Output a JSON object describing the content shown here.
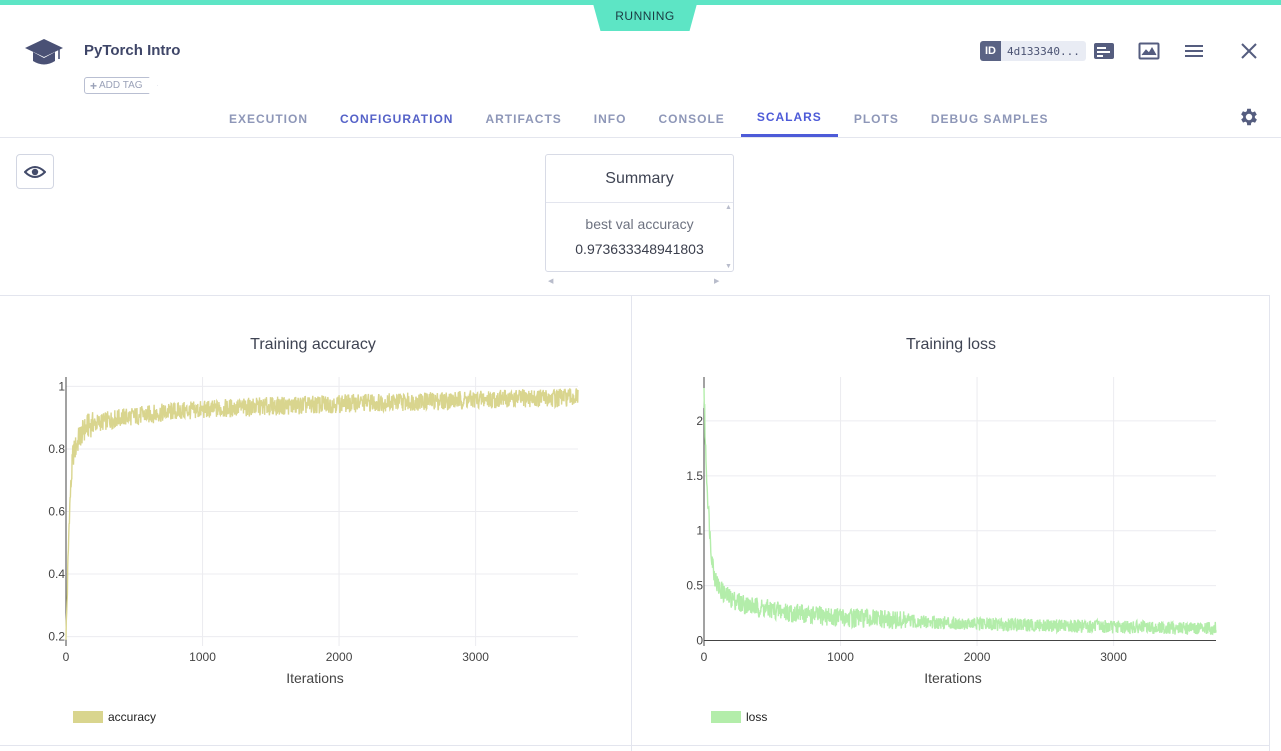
{
  "status": "RUNNING",
  "header": {
    "title": "PyTorch Intro",
    "add_tag": "ADD TAG",
    "id_label": "ID",
    "id_value": "4d133340...",
    "icons": [
      "details-icon",
      "chart-panel-icon",
      "menu-icon",
      "close-icon"
    ]
  },
  "tabs": [
    {
      "label": "EXECUTION"
    },
    {
      "label": "CONFIGURATION"
    },
    {
      "label": "ARTIFACTS"
    },
    {
      "label": "INFO"
    },
    {
      "label": "CONSOLE"
    },
    {
      "label": "SCALARS"
    },
    {
      "label": "PLOTS"
    },
    {
      "label": "DEBUG SAMPLES"
    }
  ],
  "active_tab": "SCALARS",
  "summary": {
    "title": "Summary",
    "label": "best val accuracy",
    "value": "0.973633348941803"
  },
  "colors": {
    "accent": "#4d5bd8",
    "status": "#5de5c5",
    "accuracy_series": "#d9d58e",
    "loss_series": "#b3edaa"
  },
  "chart_data": [
    {
      "type": "line",
      "title": "Training accuracy",
      "xlabel": "Iterations",
      "ylabel": "",
      "xlim": [
        0,
        3750
      ],
      "ylim": [
        0.17,
        1.03
      ],
      "xticks": [
        "0",
        "1000",
        "2000",
        "3000"
      ],
      "yticks": [
        "0.2",
        "0.4",
        "0.6",
        "0.8",
        "1"
      ],
      "grid": true,
      "legend_position": "bottom-left",
      "series": [
        {
          "name": "accuracy",
          "x": [
            0,
            25,
            50,
            100,
            150,
            200,
            300,
            400,
            500,
            600,
            700,
            800,
            900,
            1000,
            1200,
            1400,
            1600,
            1800,
            2000,
            2200,
            2400,
            2600,
            2800,
            3000,
            3200,
            3400,
            3600,
            3750
          ],
          "values": [
            0.19,
            0.6,
            0.78,
            0.84,
            0.87,
            0.88,
            0.89,
            0.9,
            0.905,
            0.91,
            0.915,
            0.92,
            0.922,
            0.925,
            0.93,
            0.935,
            0.938,
            0.94,
            0.945,
            0.948,
            0.95,
            0.952,
            0.955,
            0.958,
            0.96,
            0.962,
            0.963,
            0.965
          ]
        }
      ]
    },
    {
      "type": "line",
      "title": "Training loss",
      "xlabel": "Iterations",
      "ylabel": "",
      "xlim": [
        0,
        3750
      ],
      "ylim": [
        -0.05,
        2.4
      ],
      "xticks": [
        "0",
        "1000",
        "2000",
        "3000"
      ],
      "yticks": [
        "0",
        "0.5",
        "1",
        "1.5",
        "2"
      ],
      "grid": true,
      "legend_position": "bottom-left",
      "series": [
        {
          "name": "loss",
          "x": [
            0,
            10,
            25,
            50,
            75,
            100,
            150,
            200,
            300,
            400,
            500,
            600,
            800,
            1000,
            1200,
            1400,
            1600,
            1800,
            2000,
            2200,
            2400,
            2600,
            2800,
            3000,
            3200,
            3400,
            3600,
            3750
          ],
          "values": [
            2.3,
            1.8,
            1.35,
            0.85,
            0.6,
            0.5,
            0.42,
            0.38,
            0.33,
            0.3,
            0.28,
            0.26,
            0.23,
            0.21,
            0.2,
            0.18,
            0.17,
            0.16,
            0.15,
            0.145,
            0.14,
            0.135,
            0.13,
            0.125,
            0.12,
            0.115,
            0.11,
            0.11
          ]
        }
      ]
    }
  ]
}
